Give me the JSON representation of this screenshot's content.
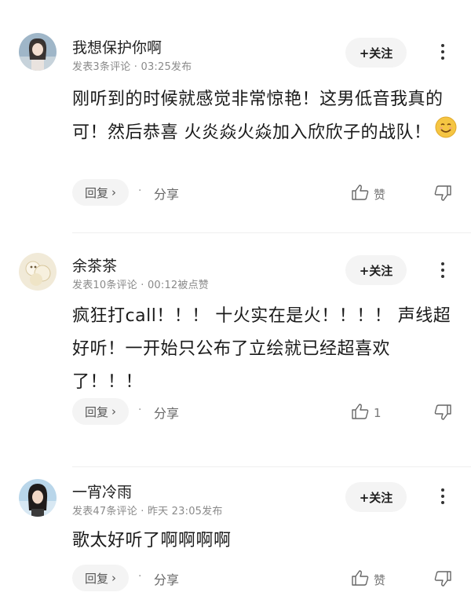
{
  "comments": [
    {
      "username": "我想保护你啊",
      "meta": "发表3条评论 · 03:25发布",
      "follow_label": "+关注",
      "body": "刚听到的时候就感觉非常惊艳！这男低音我真的可！然后恭喜 火炎焱火焱加入欣欣子的战队！",
      "reply_label": "回复",
      "reply_chevron": "›",
      "dot": "·",
      "share_label": "分享",
      "like_label": "赞",
      "emoji": "smiling-face"
    },
    {
      "username": "余茶茶",
      "meta": "发表10条评论 · 00:12被点赞",
      "follow_label": "+关注",
      "body": "疯狂打call！！！ 十火实在是火！！！！ 声线超好听！一开始只公布了立绘就已经超喜欢了！！！",
      "reply_label": "回复",
      "reply_chevron": "›",
      "dot": "·",
      "share_label": "分享",
      "like_label": "1"
    },
    {
      "username": "一宵冷雨",
      "meta": "发表47条评论 · 昨天 23:05发布",
      "follow_label": "+关注",
      "body": "歌太好听了啊啊啊啊",
      "reply_label": "回复",
      "reply_chevron": "›",
      "dot": "·",
      "share_label": "分享",
      "like_label": "赞"
    }
  ],
  "colors": {
    "button_bg": "#f4f4f4",
    "meta_text": "#8a8a8a",
    "body_text": "#1a1a1a"
  }
}
